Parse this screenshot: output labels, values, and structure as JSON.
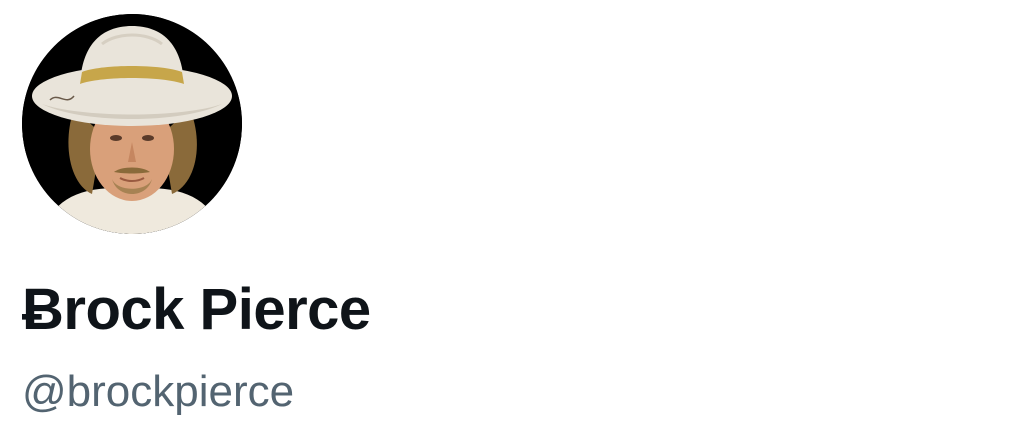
{
  "profile": {
    "display_name": "Ƀrock Pierce",
    "handle": "@brockpierce",
    "avatar": {
      "icon": "profile-photo",
      "description_colors": {
        "background": "#000000",
        "hat": "#e9e4da",
        "hat_band": "#c7a64a",
        "skin": "#d9a07a",
        "hair": "#8a6a3a",
        "shirt": "#efe9dd"
      }
    }
  },
  "colors": {
    "name_text": "#0f1419",
    "handle_text": "#536471",
    "page_background": "#ffffff"
  }
}
